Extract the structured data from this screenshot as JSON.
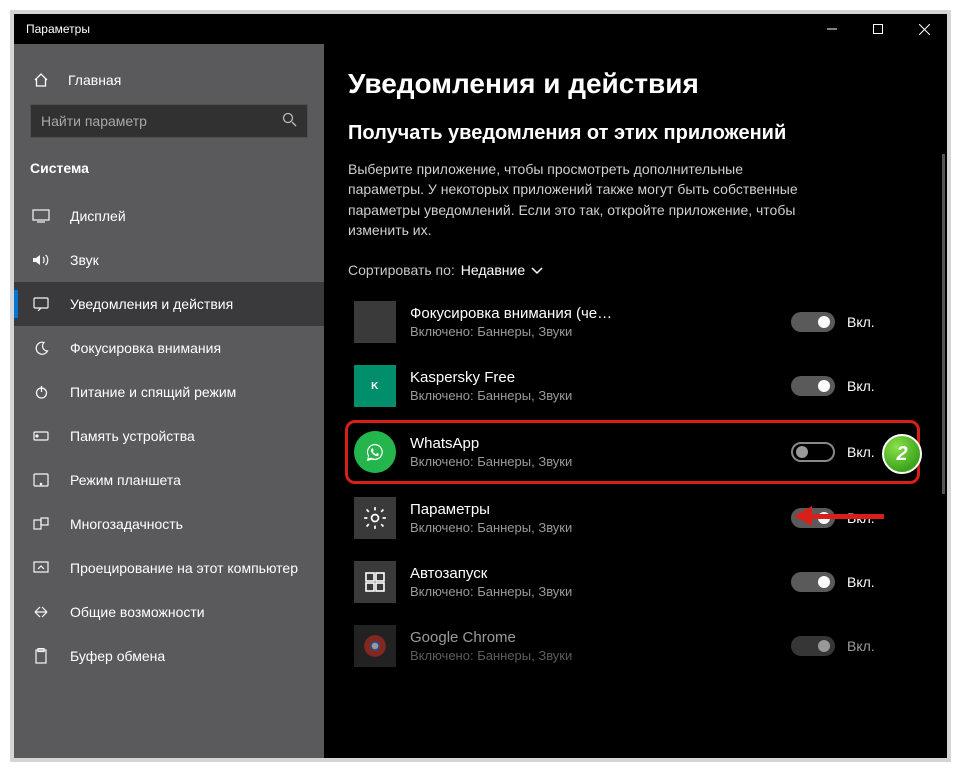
{
  "window": {
    "title": "Параметры"
  },
  "sidebar": {
    "home": "Главная",
    "search_placeholder": "Найти параметр",
    "category": "Система",
    "items": [
      {
        "label": "Дисплей"
      },
      {
        "label": "Звук"
      },
      {
        "label": "Уведомления и действия"
      },
      {
        "label": "Фокусировка внимания"
      },
      {
        "label": "Питание и спящий режим"
      },
      {
        "label": "Память устройства"
      },
      {
        "label": "Режим планшета"
      },
      {
        "label": "Многозадачность"
      },
      {
        "label": "Проецирование на этот компьютер"
      },
      {
        "label": "Общие возможности"
      },
      {
        "label": "Буфер обмена"
      }
    ]
  },
  "main": {
    "page_title": "Уведомления и действия",
    "section_title": "Получать уведомления от этих приложений",
    "description": "Выберите приложение, чтобы просмотреть дополнительные параметры. У некоторых приложений также могут быть собственные параметры уведомлений. Если это так, откройте приложение, чтобы изменить их.",
    "sort_label": "Сортировать по:",
    "sort_value": "Недавние",
    "toggle_on": "Вкл.",
    "apps": [
      {
        "name": "Фокусировка внимания (через…",
        "sub": "Включено: Баннеры, Звуки",
        "state": "Вкл."
      },
      {
        "name": "Kaspersky Free",
        "sub": "Включено: Баннеры, Звуки",
        "state": "Вкл."
      },
      {
        "name": "WhatsApp",
        "sub": "Включено: Баннеры, Звуки",
        "state": "Вкл."
      },
      {
        "name": "Параметры",
        "sub": "Включено: Баннеры, Звуки",
        "state": "Вкл."
      },
      {
        "name": "Автозапуск",
        "sub": "Включено: Баннеры, Звуки",
        "state": "Вкл."
      },
      {
        "name": "Google Chrome",
        "sub": "Включено: Баннеры, Звуки",
        "state": "Вкл."
      }
    ]
  },
  "annotation": {
    "badge": "2"
  }
}
